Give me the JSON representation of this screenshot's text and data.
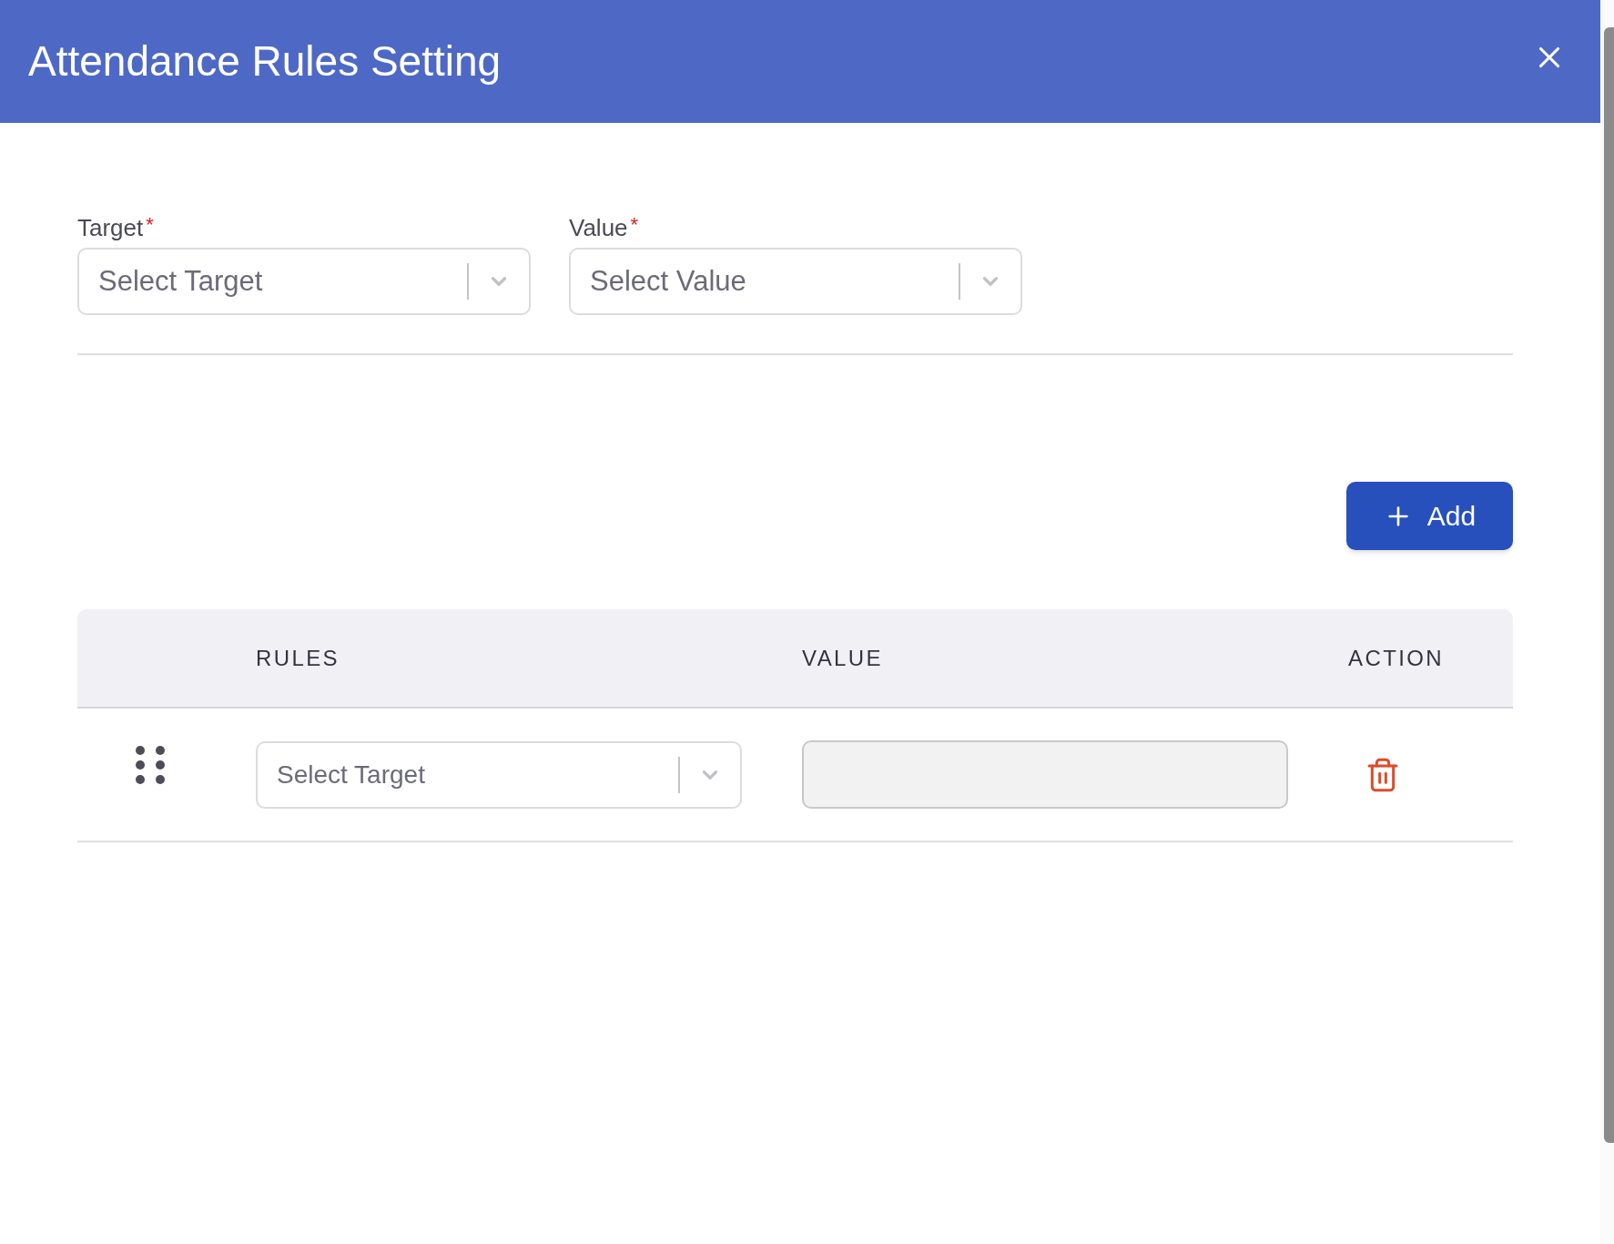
{
  "dialog": {
    "title": "Attendance Rules Setting"
  },
  "filters": [
    {
      "label": "Target",
      "required_mark": "*",
      "placeholder": "Select Target"
    },
    {
      "label": "Value",
      "required_mark": "*",
      "placeholder": "Select Value"
    }
  ],
  "add_button": {
    "label": "Add"
  },
  "table": {
    "columns": [
      "RULES",
      "VALUE",
      "ACTION"
    ],
    "rows": [
      {
        "rule": {
          "placeholder": "Select Target"
        },
        "value_field": {
          "disabled": true
        }
      }
    ]
  }
}
